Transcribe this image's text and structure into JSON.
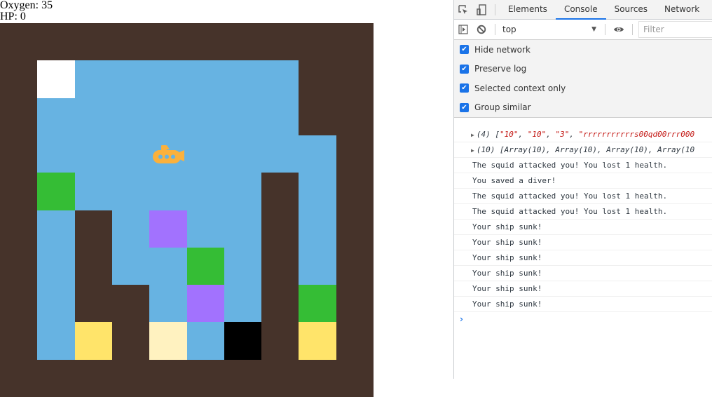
{
  "hud": {
    "oxygen": "Oxygen: 35",
    "hp": "HP: 0"
  },
  "game": {
    "rows": 10,
    "cols": 10,
    "legend": {
      "r": {
        "name": "rock",
        "color": "#46332a"
      },
      "w": {
        "name": "water",
        "color": "#67b3e2"
      },
      "s": {
        "name": "surface",
        "color": "#ffffff"
      },
      "g": {
        "name": "seaweed",
        "color": "#35bd35"
      },
      "p": {
        "name": "squid",
        "color": "#a272fe"
      },
      "y": {
        "name": "treasure",
        "color": "#ffe46a"
      },
      "c": {
        "name": "diver",
        "color": "#fff2c0"
      },
      "b": {
        "name": "hole",
        "color": "#000000"
      }
    },
    "grid": [
      "rrrrrrrrrr",
      "rswwwwwwrr",
      "rwwwwwwwrr",
      "rwwwwwwwwr",
      "rgwwwwwrwr",
      "rwrwpwwrwr",
      "rwrwwgwrwr",
      "rwrrwpwrgr",
      "rwyrcwbryr",
      "rrrrrrrrrr"
    ],
    "submarine": {
      "row": 3,
      "col": 4,
      "color": "#fbb13c"
    }
  },
  "devtools": {
    "tabs": [
      {
        "label": "Elements",
        "active": false
      },
      {
        "label": "Console",
        "active": true
      },
      {
        "label": "Sources",
        "active": false
      },
      {
        "label": "Network",
        "active": false
      }
    ],
    "context": "top",
    "filter_placeholder": "Filter",
    "settings": [
      {
        "label": "Hide network",
        "checked": true
      },
      {
        "label": "Preserve log",
        "checked": true
      },
      {
        "label": "Selected context only",
        "checked": true
      },
      {
        "label": "Group similar",
        "checked": true
      }
    ],
    "logs": [
      {
        "type": "obj",
        "prefix": "(4) [",
        "parts": [
          "\"10\"",
          ", ",
          "\"10\"",
          ", ",
          "\"3\"",
          ", ",
          "\"rrrrrrrrrrrs00qd00rrr000"
        ]
      },
      {
        "type": "obj",
        "prefix": "(10) [Array(10), Array(10), Array(10), Array(10"
      },
      {
        "type": "text",
        "text": "The squid attacked you! You lost 1 health."
      },
      {
        "type": "text",
        "text": "You saved a diver!"
      },
      {
        "type": "text",
        "text": "The squid attacked you! You lost 1 health."
      },
      {
        "type": "text",
        "text": "The squid attacked you! You lost 1 health."
      },
      {
        "type": "text",
        "text": "Your ship sunk!"
      },
      {
        "type": "text",
        "text": "Your ship sunk!"
      },
      {
        "type": "text",
        "text": "Your ship sunk!"
      },
      {
        "type": "text",
        "text": "Your ship sunk!"
      },
      {
        "type": "text",
        "text": "Your ship sunk!"
      },
      {
        "type": "text",
        "text": "Your ship sunk!"
      }
    ],
    "prompt": "›"
  }
}
